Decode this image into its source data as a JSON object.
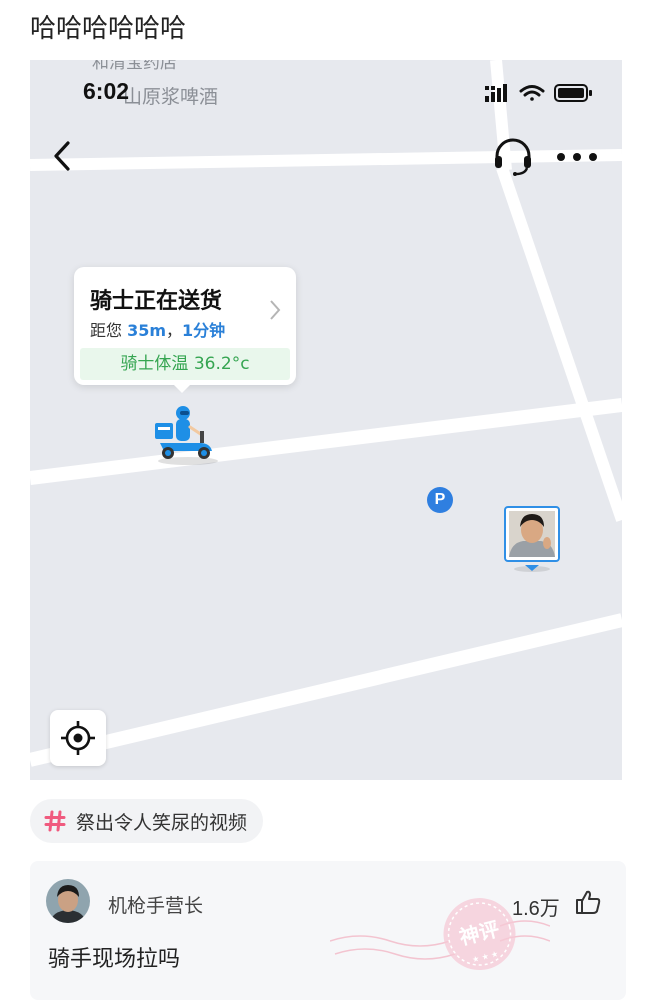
{
  "post": {
    "title": "哈哈哈哈哈哈"
  },
  "map": {
    "street_label_top": "和清宝药店",
    "street_label": "山原浆啤酒",
    "status_time": "6:02",
    "popup": {
      "title": "骑士正在送货",
      "distance_prefix": "距您 ",
      "distance": "35m",
      "separator": "，",
      "eta": "1分钟",
      "temperature": "骑士体温 36.2°c"
    },
    "parking_label": "P",
    "icons": [
      "back-icon",
      "headset-icon",
      "more-icon",
      "rider-scooter-icon",
      "parking-icon",
      "locate-icon"
    ]
  },
  "topic": {
    "label": "祭出令人笑尿的视频",
    "color": "#f05a7e"
  },
  "comment": {
    "username": "机枪手营长",
    "text": "骑手现场拉吗",
    "likes": "1.6万",
    "badge": "神评"
  },
  "colors": {
    "accent_blue": "#2a80d8",
    "temp_green": "#35a551",
    "badge_pink": "#ec7f9b"
  }
}
